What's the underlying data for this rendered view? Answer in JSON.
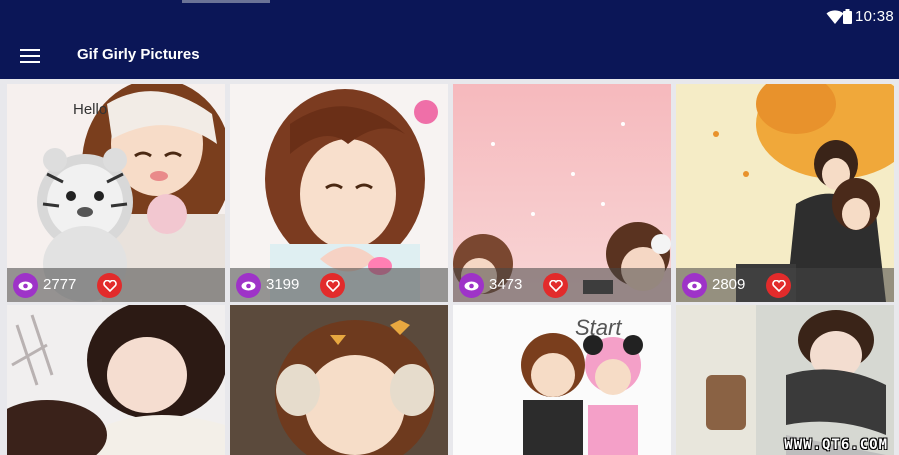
{
  "status_bar": {
    "time": "10:38",
    "icons": [
      "wifi-icon",
      "battery-icon"
    ]
  },
  "app_bar": {
    "title": "Gif Girly Pictures",
    "menu_icon": "hamburger-menu-icon"
  },
  "tiles_row1": [
    {
      "views": "2777",
      "overlay_art_text": "Hello"
    },
    {
      "views": "3199"
    },
    {
      "views": "3473"
    },
    {
      "views": "2809"
    }
  ],
  "tiles_row2": [
    {},
    {},
    {
      "overlay_art_text": "Start"
    },
    {}
  ],
  "watermark": "WWW.QT6.COM",
  "colors": {
    "primary": "#0b1657",
    "views_badge": "#9e33c8",
    "like_badge": "#e22b2b"
  }
}
